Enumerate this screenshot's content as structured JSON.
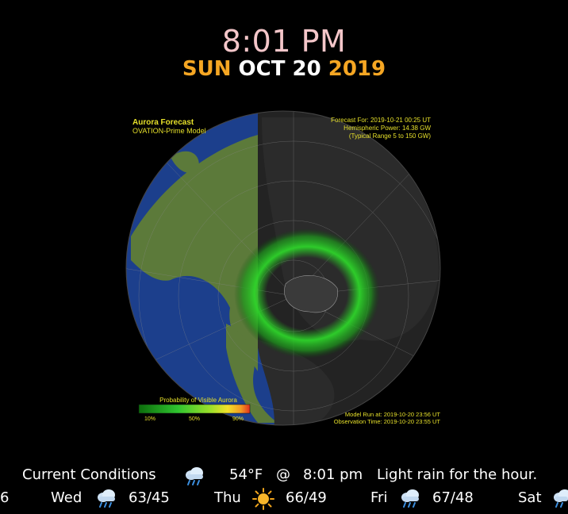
{
  "clock": {
    "time": "8:01 PM",
    "day": "SUN",
    "month_day": "OCT 20",
    "year": "2019"
  },
  "map": {
    "title": "Aurora Forecast",
    "subtitle": "OVATION-Prime Model",
    "forecast_for": "Forecast For: 2019-10-21 00:25 UT",
    "hemispheric_power": "Hemispheric Power: 14.38 GW",
    "typical_range": "(Typical Range 5 to 150 GW)",
    "legend_title": "Probability of Visible Aurora",
    "legend_ticks": [
      "10%",
      "50%",
      "90%"
    ],
    "model_run": "Model Run at: 2019-10-20 23:56 UT",
    "observation_time": "Observation Time: 2019-10-20 23:55 UT",
    "colors": {
      "ocean": "#1c3f8c",
      "land_day": "#5c7a3a",
      "night": "#222222",
      "aurora": "#22c41e"
    }
  },
  "current": {
    "label": "Current Conditions",
    "icon": "rain-cloud-icon",
    "temp": "54°F",
    "at": "@",
    "time": "8:01 pm",
    "summary": "Light rain for the hour."
  },
  "forecast": {
    "partial_left": "6",
    "days": [
      {
        "day": "Wed",
        "icon": "rain-cloud-icon",
        "temps": "63/45"
      },
      {
        "day": "Thu",
        "icon": "sun-icon",
        "temps": "66/49"
      },
      {
        "day": "Fri",
        "icon": "rain-cloud-icon",
        "temps": "67/48"
      },
      {
        "day": "Sat",
        "icon": "rain-cloud-icon",
        "temps": ""
      }
    ]
  }
}
